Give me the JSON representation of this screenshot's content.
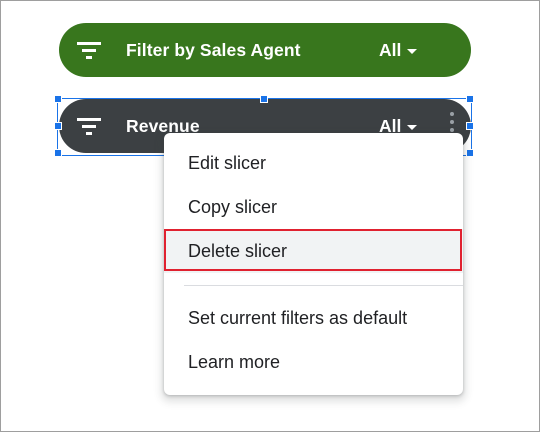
{
  "slicers": [
    {
      "title": "Filter by Sales Agent",
      "value": "All",
      "color": "#38761d",
      "icon": "filter-list-icon",
      "selected": false
    },
    {
      "title": "Revenue",
      "value": "All",
      "color": "#3c4043",
      "icon": "filter-list-icon",
      "selected": true,
      "more_icon": "more-vert-icon"
    }
  ],
  "context_menu": {
    "items": [
      {
        "label": "Edit slicer"
      },
      {
        "label": "Copy slicer"
      },
      {
        "label": "Delete slicer",
        "highlighted": true
      },
      {
        "label": "Set current filters as default"
      },
      {
        "label": "Learn more"
      }
    ],
    "highlight_color": "#e0212f"
  },
  "selection_color": "#1a73e8"
}
